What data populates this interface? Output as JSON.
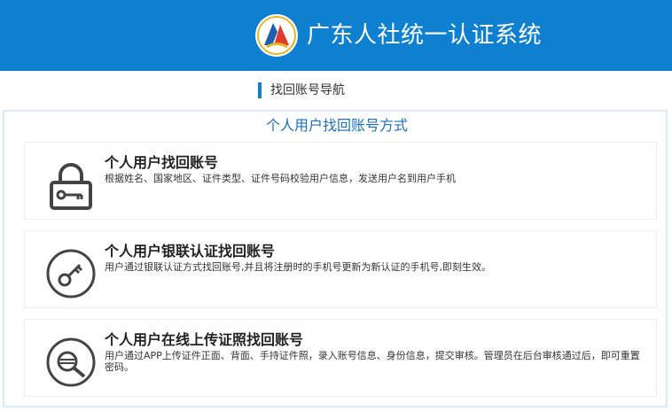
{
  "header": {
    "title": "广东人社统一认证系统",
    "colors": {
      "bar": "#0f7fd0",
      "title": "#ffffff"
    },
    "logo_icon": "guangdong-hrss-logo"
  },
  "nav": {
    "label": "找回账号导航"
  },
  "panel": {
    "title": "个人用户找回账号方式",
    "cards": [
      {
        "icon": "padlock-icon",
        "title": "个人用户找回账号",
        "description": "根据姓名、国家地区、证件类型、证件号码校验用户信息，发送用户名到用户手机"
      },
      {
        "icon": "key-icon",
        "title": "个人用户银联认证找回账号",
        "description": "用户通过银联认证方式找回账号,并且将注册时的手机号更新为新认证的手机号,即刻生效。"
      },
      {
        "icon": "id-card-search-icon",
        "title": "个人用户在线上传证照找回账号",
        "description": "用户通过APP上传证件正面、背面、手持证件照，录入账号信息、身份信息，提交审核。管理员在后台审核通过后，即可重置密码。"
      }
    ]
  }
}
